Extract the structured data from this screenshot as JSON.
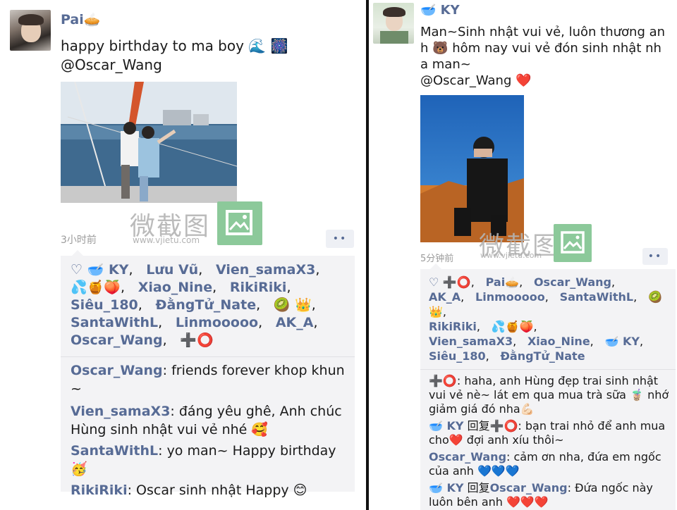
{
  "left_post": {
    "author": "Pai🥧",
    "text_line1": "happy birthday to ma boy 🌊 🎆",
    "text_line2": "@Oscar_Wang",
    "time": "3小时前",
    "more": "••",
    "likes_heart": "♡",
    "likes": [
      "🥣 KY",
      "Lưu Vũ",
      "Vien_samaX3",
      "💦🍯🍑",
      "Xiao_Nine",
      "RikiRiki",
      "Siêu_180",
      "ĐằngTử_Nate",
      "🥝 👑",
      "SantaWithL",
      "Linmooooo",
      "AK_A",
      "Oscar_Wang",
      "➕⭕"
    ],
    "comments": [
      {
        "who": "Oscar_Wang",
        "text": ": friends forever khop khun ~"
      },
      {
        "who": "Vien_samaX3",
        "text": ": đáng yêu ghê, Anh chúc Hùng sinh nhật vui vẻ nhé 🥰"
      },
      {
        "who": "SantaWithL",
        "text": ": yo man~ Happy birthday 🥳"
      },
      {
        "who": "RikiRiki",
        "text": ": Oscar sinh nhật Happy 😊"
      }
    ]
  },
  "right_post": {
    "author": "🥣 KY",
    "text_line1": "Man~Sinh nhật vui vẻ, luôn thương an",
    "text_line2": "h 🐻 hôm nay vui vẻ đón sinh nhật nh",
    "text_line3": "a man~",
    "text_line4": "@Oscar_Wang ❤️",
    "time": "5分钟前",
    "more": "••",
    "likes_heart": "♡",
    "likes": [
      "➕⭕",
      "Pai🥧",
      "Oscar_Wang",
      "AK_A",
      "Linmooooo",
      "SantaWithL",
      "🥝 👑",
      "RikiRiki",
      "💦🍯🍑",
      "Vien_samaX3",
      "Xiao_Nine",
      "🥣 KY",
      "Siêu_180",
      "ĐằngTử_Nate"
    ],
    "comments": [
      {
        "who": "➕⭕",
        "text": ": haha, anh Hùng đẹp trai sinh nhật vui vẻ nè~ lát em qua mua trà sữa 🧋 nhớ giảm giá đó nha💪🏻"
      },
      {
        "who": "🥣 KY",
        "reply": " 回复",
        "who2": "➕⭕",
        "text": ": bạn trai nhỏ để anh mua cho❤️ đợi anh xíu thôi~"
      },
      {
        "who": "Oscar_Wang",
        "text": ": cảm ơn nha, đứa em ngốc của anh 💙💙💙"
      },
      {
        "who": "🥣 KY",
        "reply": " 回复",
        "who2": "Oscar_Wang",
        "text": ": Đứa ngốc này luôn bên anh ❤️❤️❤️"
      }
    ]
  },
  "watermark": {
    "zh": "微截图",
    "url": "www.vjietu.com"
  },
  "colors": {
    "name": "#576b95",
    "likes_bg": "#f3f3f5",
    "watermark_green": "#8cc99a"
  }
}
